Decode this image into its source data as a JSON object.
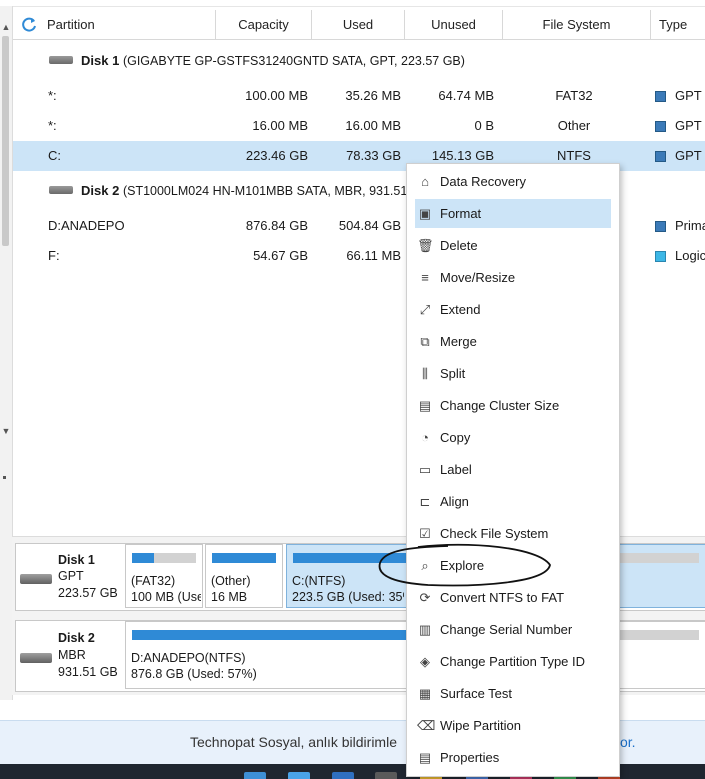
{
  "header": {
    "columns": [
      "Partition",
      "Capacity",
      "Used",
      "Unused",
      "File System",
      "Type"
    ]
  },
  "disk1": {
    "name": "Disk 1",
    "detail": "(GIGABYTE GP-GSTFS31240GNTD SATA, GPT, 223.57 GB)"
  },
  "disk2": {
    "name": "Disk 2",
    "detail": "(ST1000LM024 HN-M101MBB SATA, MBR, 931.51"
  },
  "rows": [
    {
      "partition": "*:",
      "capacity": "100.00 MB",
      "used": "35.26 MB",
      "unused": "64.74 MB",
      "fs": "FAT32",
      "type": "GPT ("
    },
    {
      "partition": "*:",
      "capacity": "16.00 MB",
      "used": "16.00 MB",
      "unused": "0 B",
      "fs": "Other",
      "type": "GPT ("
    },
    {
      "partition": "C:",
      "capacity": "223.46 GB",
      "used": "78.33 GB",
      "unused": "145.13 GB",
      "fs": "NTFS",
      "type": "GPT ("
    },
    {
      "partition": "D:ANADEPO",
      "capacity": "876.84 GB",
      "used": "504.84 GB",
      "type": "Prima"
    },
    {
      "partition": "F:",
      "capacity": "54.67 GB",
      "used": "66.11 MB",
      "type": "Logic"
    }
  ],
  "map": {
    "disk1": {
      "name": "Disk 1",
      "style": "GPT",
      "size": "223.57 GB"
    },
    "disk2": {
      "name": "Disk 2",
      "style": "MBR",
      "size": "931.51 GB"
    },
    "parts1": [
      {
        "line1": "(FAT32)",
        "line2": "100 MB (Use",
        "fill_pct": 35
      },
      {
        "line1": "(Other)",
        "line2": "16 MB",
        "fill_pct": 100
      },
      {
        "line1": "C:(NTFS)",
        "line2": "223.5 GB (Used: 35%",
        "fill_pct": 35
      }
    ],
    "parts2": [
      {
        "line1": "D:ANADEPO(NTFS)",
        "line2": "876.8 GB (Used: 57%)",
        "fill_pct": 57
      }
    ]
  },
  "menu": [
    {
      "label": "Data Recovery",
      "icon": "data-recovery-icon",
      "glyph": "⌂"
    },
    {
      "label": "Format",
      "icon": "format-icon",
      "glyph": "▣"
    },
    {
      "label": "Delete",
      "icon": "trash-icon",
      "glyph": "🗑"
    },
    {
      "label": "Move/Resize",
      "icon": "move-resize-icon",
      "glyph": "≡"
    },
    {
      "label": "Extend",
      "icon": "extend-icon",
      "glyph": "⤢"
    },
    {
      "label": "Merge",
      "icon": "merge-icon",
      "glyph": "⧉"
    },
    {
      "label": "Split",
      "icon": "split-icon",
      "glyph": "⫼"
    },
    {
      "label": "Change Cluster Size",
      "icon": "cluster-size-icon",
      "glyph": "▤"
    },
    {
      "label": "Copy",
      "icon": "copy-icon",
      "glyph": "◔"
    },
    {
      "label": "Label",
      "icon": "label-icon",
      "glyph": "▭"
    },
    {
      "label": "Align",
      "icon": "align-icon",
      "glyph": "⊏"
    },
    {
      "label": "Check File System",
      "icon": "check-fs-icon",
      "glyph": "☑"
    },
    {
      "label": "Explore",
      "icon": "explore-icon",
      "glyph": "⌕"
    },
    {
      "label": "Convert NTFS to FAT",
      "icon": "convert-icon",
      "glyph": "⟳"
    },
    {
      "label": "Change Serial Number",
      "icon": "barcode-icon",
      "glyph": "▥"
    },
    {
      "label": "Change Partition Type ID",
      "icon": "layers-icon",
      "glyph": "◈"
    },
    {
      "label": "Surface Test",
      "icon": "surface-test-icon",
      "glyph": "▦"
    },
    {
      "label": "Wipe Partition",
      "icon": "wipe-icon",
      "glyph": "⌫"
    },
    {
      "label": "Properties",
      "icon": "properties-icon",
      "glyph": "▤"
    }
  ],
  "notice": {
    "text": "Technopat Sosyal, anlık bildirimle",
    "link": "or."
  },
  "colors": {
    "accent": "#2f8ad6",
    "selection": "#cce4f7"
  }
}
